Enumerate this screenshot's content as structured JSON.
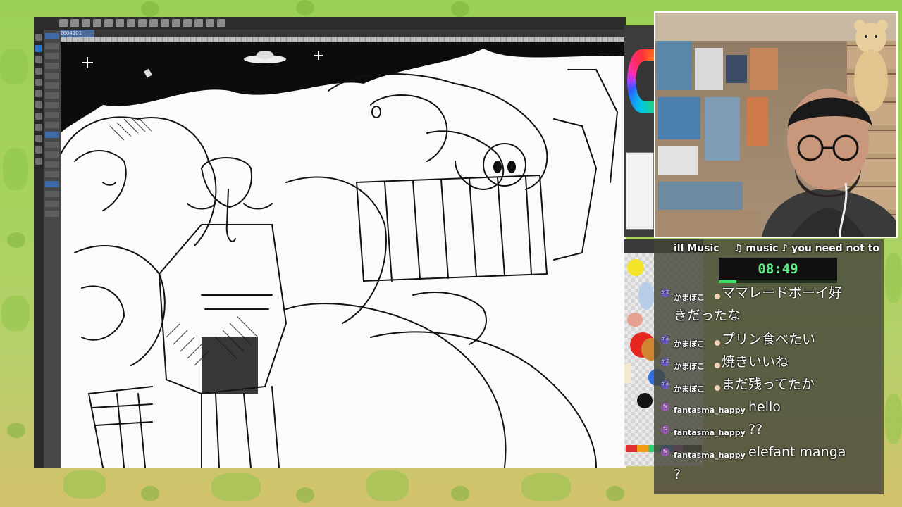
{
  "app": {
    "document_tab": "2604101"
  },
  "stream": {
    "music_left": "ill Music",
    "music_right": "♫ music ♪ you need not to",
    "timer": "08:49",
    "timer_progress": 0.15
  },
  "chat": {
    "messages": [
      {
        "user": "かまぼこ",
        "badge": "かま",
        "line1": "ママレードボーイ好",
        "line2": "きだったな"
      },
      {
        "user": "かまぼこ",
        "badge": "かま",
        "line1": "プリン食べたい"
      },
      {
        "user": "かまぼこ",
        "badge": "かま",
        "line1": "焼きいいね"
      },
      {
        "user": "かまぼこ",
        "badge": "かま",
        "line1": "まだ残ってたか"
      },
      {
        "user": "fantasma_happy",
        "badge": "fa",
        "line1": "hello"
      },
      {
        "user": "fantasma_happy",
        "badge": "fa",
        "line1": "??"
      },
      {
        "user": "fantasma_happy",
        "badge": "fa",
        "line1": "elefant manga",
        "line2": "?"
      }
    ]
  },
  "colors": {
    "timer_text": "#5ff08c",
    "accent_blue": "#2a74c8",
    "chat_bg": "#46463a"
  },
  "palette_swatches": [
    "#f5e52a",
    "#b8cde8",
    "#e6a090",
    "#e52520",
    "#d08530",
    "#2b6fe0",
    "#111111",
    "#f3e9d0"
  ]
}
